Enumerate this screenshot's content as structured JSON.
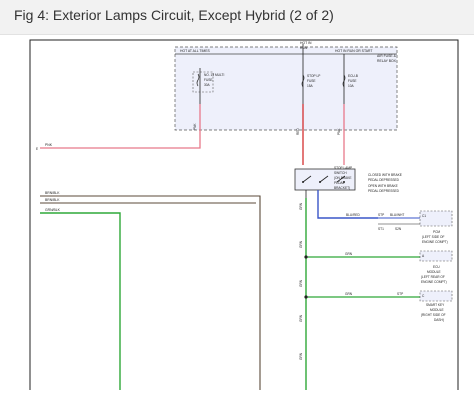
{
  "title": "Fig 4: Exterior Lamps Circuit, Except Hybrid (2 of 2)",
  "fuse_box": {
    "hot_all_times": "HOT AT ALL TIMES",
    "hot_in_run": [
      "HOT IN",
      "RUN"
    ],
    "hot_in_run_start": "HOT IN RUN OR START",
    "name": [
      "AIR FUSE &",
      "RELAY BOX"
    ],
    "fuse_multi": [
      "NO. 13",
      "MULTI",
      "FUSE",
      "30A"
    ],
    "fuse_stop_lp": [
      "STOP LP",
      "FUSE",
      "15A"
    ],
    "fuse_ecu": [
      "ECU-B",
      "FUSE",
      "10A"
    ]
  },
  "wires": {
    "pnk_left": "PNK",
    "pnk_vertical": "PNK",
    "red": "RED",
    "pnk_right": "PNK",
    "brn_blk_1": "BRN/BLK",
    "brn_blk_2": "BRN/BLK",
    "grn_blk": "GRN/BLK",
    "grn_1": "GRN",
    "grn_2": "GRN",
    "blu_red": "BLU/RED",
    "blu_wht": "BLU/WHT",
    "wire_codes": [
      "GRN",
      "GRN",
      "GRN",
      "GRN",
      "GRN"
    ]
  },
  "stop_switch": {
    "label": [
      "STOP LAMP",
      "SWITCH",
      "(ON BRAKE",
      "PEDAL",
      "BRACKET)"
    ],
    "legend_closed": [
      "CLOSED WITH BRAKE",
      "PEDAL DEPRESSED"
    ],
    "legend_open": [
      "OPEN WITH BRAKE",
      "PEDAL DEPRESSED"
    ]
  },
  "modules": {
    "pcm": [
      "PCM",
      "(LEFT SIDE OF",
      "ENGINE COMPT)"
    ],
    "pcm_pins": [
      "STP",
      "ST1",
      "S2N"
    ],
    "ecm_module": [
      "ECU",
      "MODULE",
      "(LEFT REAR OF",
      "ENGINE COMPT)"
    ],
    "smart_key": [
      "SMART KEY",
      "MODULE",
      "(RIGHT SIDE OF",
      "DASH)"
    ],
    "smart_pin": "STP",
    "connector_tags": [
      "C1",
      "A",
      "C",
      "E"
    ]
  }
}
